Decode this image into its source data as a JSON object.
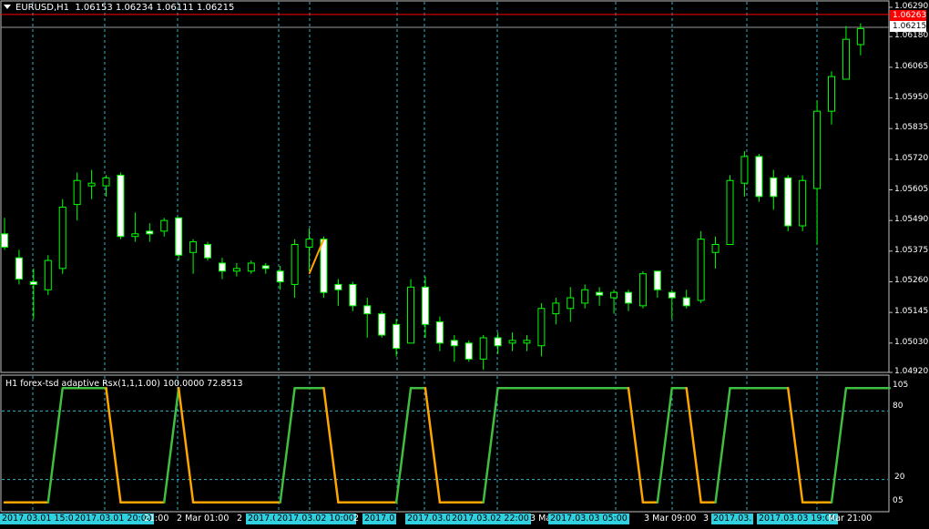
{
  "main_chart": {
    "symbol": "EURUSD,H1",
    "ohlc": "1.06153 1.06234 1.06111 1.06215",
    "ask_price": "1.06263",
    "bid_price": "1.06215",
    "price_labels": [
      "1.06290",
      "1.06180",
      "1.06065",
      "1.05950",
      "1.05835",
      "1.05720",
      "1.05605",
      "1.05490",
      "1.05375",
      "1.05260",
      "1.05145",
      "1.05030",
      "1.04920"
    ],
    "price_values": [
      1.0629,
      1.0618,
      1.06065,
      1.0595,
      1.05835,
      1.0572,
      1.05605,
      1.0549,
      1.05375,
      1.0526,
      1.05145,
      1.0503,
      1.0492
    ],
    "price_range": [
      1.0492,
      1.0629
    ],
    "up_color": "#00ff00",
    "down_color": "#ffffff",
    "candles": [
      {
        "o": 1.0544,
        "h": 1.055,
        "l": 1.0538,
        "c": 1.0539
      },
      {
        "o": 1.0535,
        "h": 1.0538,
        "l": 1.0525,
        "c": 1.0527
      },
      {
        "o": 1.0526,
        "h": 1.0531,
        "l": 1.0512,
        "c": 1.0525
      },
      {
        "o": 1.0523,
        "h": 1.0536,
        "l": 1.0521,
        "c": 1.0534
      },
      {
        "o": 1.0531,
        "h": 1.0557,
        "l": 1.0529,
        "c": 1.0554
      },
      {
        "o": 1.0555,
        "h": 1.0567,
        "l": 1.0549,
        "c": 1.0564
      },
      {
        "o": 1.0562,
        "h": 1.0568,
        "l": 1.0557,
        "c": 1.0563
      },
      {
        "o": 1.0562,
        "h": 1.0566,
        "l": 1.0558,
        "c": 1.0565
      },
      {
        "o": 1.0566,
        "h": 1.0567,
        "l": 1.0542,
        "c": 1.0543
      },
      {
        "o": 1.0543,
        "h": 1.0552,
        "l": 1.0541,
        "c": 1.0544
      },
      {
        "o": 1.0545,
        "h": 1.0548,
        "l": 1.0541,
        "c": 1.0544
      },
      {
        "o": 1.0545,
        "h": 1.055,
        "l": 1.0543,
        "c": 1.0549
      },
      {
        "o": 1.055,
        "h": 1.055,
        "l": 1.0534,
        "c": 1.0536
      },
      {
        "o": 1.0537,
        "h": 1.0542,
        "l": 1.0529,
        "c": 1.0541
      },
      {
        "o": 1.054,
        "h": 1.0541,
        "l": 1.0534,
        "c": 1.0535
      },
      {
        "o": 1.0533,
        "h": 1.0535,
        "l": 1.0527,
        "c": 1.053
      },
      {
        "o": 1.053,
        "h": 1.0533,
        "l": 1.0528,
        "c": 1.0531
      },
      {
        "o": 1.053,
        "h": 1.0534,
        "l": 1.0529,
        "c": 1.0533
      },
      {
        "o": 1.0532,
        "h": 1.0533,
        "l": 1.0529,
        "c": 1.0531
      },
      {
        "o": 1.053,
        "h": 1.0532,
        "l": 1.0523,
        "c": 1.0526
      },
      {
        "o": 1.0525,
        "h": 1.0542,
        "l": 1.052,
        "c": 1.054
      },
      {
        "o": 1.0539,
        "h": 1.0546,
        "l": 1.053,
        "c": 1.0542
      },
      {
        "o": 1.0542,
        "h": 1.0543,
        "l": 1.052,
        "c": 1.0522
      },
      {
        "o": 1.0525,
        "h": 1.0527,
        "l": 1.0517,
        "c": 1.0523
      },
      {
        "o": 1.0525,
        "h": 1.0526,
        "l": 1.0515,
        "c": 1.0517
      },
      {
        "o": 1.0517,
        "h": 1.052,
        "l": 1.0505,
        "c": 1.0514
      },
      {
        "o": 1.0514,
        "h": 1.0515,
        "l": 1.0505,
        "c": 1.0506
      },
      {
        "o": 1.051,
        "h": 1.0512,
        "l": 1.0498,
        "c": 1.0501
      },
      {
        "o": 1.0503,
        "h": 1.0527,
        "l": 1.0503,
        "c": 1.0524
      },
      {
        "o": 1.0524,
        "h": 1.0528,
        "l": 1.0505,
        "c": 1.051
      },
      {
        "o": 1.0511,
        "h": 1.0513,
        "l": 1.05,
        "c": 1.0503
      },
      {
        "o": 1.0504,
        "h": 1.0506,
        "l": 1.0496,
        "c": 1.0502
      },
      {
        "o": 1.0503,
        "h": 1.0504,
        "l": 1.0496,
        "c": 1.0497
      },
      {
        "o": 1.0497,
        "h": 1.0506,
        "l": 1.0493,
        "c": 1.0505
      },
      {
        "o": 1.0505,
        "h": 1.0507,
        "l": 1.0499,
        "c": 1.0502
      },
      {
        "o": 1.0503,
        "h": 1.0507,
        "l": 1.05,
        "c": 1.0504
      },
      {
        "o": 1.0503,
        "h": 1.0506,
        "l": 1.05,
        "c": 1.0504
      },
      {
        "o": 1.0502,
        "h": 1.0518,
        "l": 1.0498,
        "c": 1.0516
      },
      {
        "o": 1.0514,
        "h": 1.052,
        "l": 1.051,
        "c": 1.0518
      },
      {
        "o": 1.0516,
        "h": 1.0524,
        "l": 1.0511,
        "c": 1.052
      },
      {
        "o": 1.0518,
        "h": 1.0525,
        "l": 1.0516,
        "c": 1.0523
      },
      {
        "o": 1.0522,
        "h": 1.0524,
        "l": 1.0517,
        "c": 1.0521
      },
      {
        "o": 1.052,
        "h": 1.0523,
        "l": 1.0514,
        "c": 1.0522
      },
      {
        "o": 1.0522,
        "h": 1.0523,
        "l": 1.0515,
        "c": 1.0518
      },
      {
        "o": 1.0517,
        "h": 1.053,
        "l": 1.0516,
        "c": 1.0529
      },
      {
        "o": 1.053,
        "h": 1.053,
        "l": 1.052,
        "c": 1.0523
      },
      {
        "o": 1.0522,
        "h": 1.0523,
        "l": 1.0512,
        "c": 1.052
      },
      {
        "o": 1.052,
        "h": 1.0523,
        "l": 1.0516,
        "c": 1.0517
      },
      {
        "o": 1.0519,
        "h": 1.0545,
        "l": 1.0518,
        "c": 1.0542
      },
      {
        "o": 1.0537,
        "h": 1.0543,
        "l": 1.0531,
        "c": 1.054
      },
      {
        "o": 1.054,
        "h": 1.0566,
        "l": 1.054,
        "c": 1.0564
      },
      {
        "o": 1.0563,
        "h": 1.0575,
        "l": 1.0558,
        "c": 1.0573
      },
      {
        "o": 1.0573,
        "h": 1.0574,
        "l": 1.0556,
        "c": 1.0558
      },
      {
        "o": 1.0565,
        "h": 1.0568,
        "l": 1.0553,
        "c": 1.0558
      },
      {
        "o": 1.0565,
        "h": 1.0566,
        "l": 1.0545,
        "c": 1.0547
      },
      {
        "o": 1.0547,
        "h": 1.0566,
        "l": 1.0545,
        "c": 1.0564
      },
      {
        "o": 1.0561,
        "h": 1.0594,
        "l": 1.054,
        "c": 1.059
      },
      {
        "o": 1.059,
        "h": 1.0605,
        "l": 1.0585,
        "c": 1.0603
      },
      {
        "o": 1.0602,
        "h": 1.0622,
        "l": 1.0602,
        "c": 1.0617
      },
      {
        "o": 1.0615,
        "h": 1.0623,
        "l": 1.0611,
        "c": 1.0621
      }
    ],
    "orange_segment": {
      "from_index": 21,
      "to_index": 22,
      "from_price": 1.0529,
      "to_price": 1.0542,
      "color": "#ffa500"
    }
  },
  "indicator": {
    "title": "H1 forex-tsd adaptive Rsx(1,1,1.00) 100.0000 72.8513",
    "level_labels": [
      "105",
      "80",
      "20",
      "0",
      "5"
    ],
    "level_values": [
      105,
      80,
      20,
      0,
      5
    ],
    "range": [
      -5,
      105
    ],
    "dotted_levels": [
      80,
      20
    ],
    "up_color": "#3fbf3f",
    "down_color": "#ffa500",
    "values": [
      0,
      0,
      0,
      0,
      100,
      100,
      100,
      100,
      0,
      0,
      0,
      0,
      100,
      0,
      0,
      0,
      0,
      0,
      0,
      0,
      100,
      100,
      100,
      0,
      0,
      0,
      0,
      0,
      100,
      100,
      0,
      0,
      0,
      0,
      100,
      100,
      100,
      100,
      100,
      100,
      100,
      100,
      100,
      100,
      0,
      0,
      100,
      100,
      0,
      0,
      100,
      100,
      100,
      100,
      100,
      0,
      0,
      0,
      100,
      100,
      100,
      100
    ]
  },
  "time_axis": [
    {
      "label": "2017.03.01 15:00",
      "highlight": true
    },
    {
      "label": "2017.03.01 20:00",
      "highlight": true
    },
    {
      "label": "21:00",
      "highlight": false
    },
    {
      "label": "2 Mar 01:00",
      "highlight": false
    },
    {
      "label": "2 Mar 05:00",
      "highlight": false
    },
    {
      "label": "2017.0",
      "highlight": true
    },
    {
      "label": "2017.03.02 10:00",
      "highlight": true
    },
    {
      "label": "2",
      "highlight": false
    },
    {
      "label": "2017.0",
      "highlight": true
    },
    {
      "label": "2017.03.02 18",
      "highlight": true
    },
    {
      "label": "2017.03.02 22:00",
      "highlight": true
    },
    {
      "label": "3 Mar",
      "highlight": false
    },
    {
      "label": "2017.03.03 05:00",
      "highlight": true
    },
    {
      "label": "3 Mar 09:00",
      "highlight": false
    },
    {
      "label": "3",
      "highlight": false
    },
    {
      "label": "2017.03.",
      "highlight": true
    },
    {
      "label": "2017.03.03 19:00",
      "highlight": true
    },
    {
      "label": "Mar 21:00",
      "highlight": false
    }
  ],
  "colors": {
    "background": "#000000",
    "grid": "#3fd2e6",
    "frame": "#c0c0c0",
    "ask_line": "#ff0000",
    "bid_line": "#9a9a9a"
  }
}
